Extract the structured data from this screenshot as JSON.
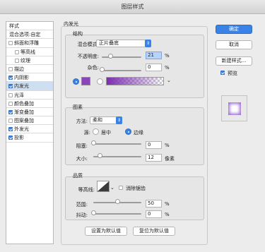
{
  "window": {
    "title": "图层样式"
  },
  "sidebar": {
    "items": [
      {
        "label": "样式",
        "checkbox": null,
        "checked": false,
        "indent": 0,
        "selected": false
      },
      {
        "label": "混合选项:自定",
        "checkbox": null,
        "checked": false,
        "indent": 0,
        "selected": false
      },
      {
        "label": "斜面和浮雕",
        "checkbox": true,
        "checked": false,
        "indent": 0,
        "selected": false
      },
      {
        "label": "等高线",
        "checkbox": true,
        "checked": false,
        "indent": 1,
        "selected": false
      },
      {
        "label": "纹理",
        "checkbox": true,
        "checked": false,
        "indent": 1,
        "selected": false
      },
      {
        "label": "描边",
        "checkbox": true,
        "checked": false,
        "indent": 0,
        "selected": false
      },
      {
        "label": "内阴影",
        "checkbox": true,
        "checked": true,
        "indent": 0,
        "selected": false
      },
      {
        "label": "内发光",
        "checkbox": true,
        "checked": true,
        "indent": 0,
        "selected": true
      },
      {
        "label": "光泽",
        "checkbox": true,
        "checked": false,
        "indent": 0,
        "selected": false
      },
      {
        "label": "颜色叠加",
        "checkbox": true,
        "checked": false,
        "indent": 0,
        "selected": false
      },
      {
        "label": "渐变叠加",
        "checkbox": true,
        "checked": true,
        "indent": 0,
        "selected": false
      },
      {
        "label": "图案叠加",
        "checkbox": true,
        "checked": false,
        "indent": 0,
        "selected": false
      },
      {
        "label": "外发光",
        "checkbox": true,
        "checked": true,
        "indent": 0,
        "selected": false
      },
      {
        "label": "投影",
        "checkbox": true,
        "checked": true,
        "indent": 0,
        "selected": false
      }
    ]
  },
  "panel": {
    "title": "内发光"
  },
  "structure": {
    "title": "结构",
    "blend_mode_label": "混合模式:",
    "blend_mode_value": "正片叠底",
    "opacity_label": "不透明度:",
    "opacity_value": "21",
    "opacity_level": 0.21,
    "noise_label": "杂色:",
    "noise_value": "0",
    "noise_level": 0,
    "percent": "%",
    "color_selected": "solid",
    "swatch_color": "#8a45b8",
    "gradient_color": "#7a2db0"
  },
  "elements": {
    "title": "图素",
    "method_label": "方法:",
    "method_value": "柔和",
    "source_label": "源:",
    "source_center": "居中",
    "source_edge": "边缘",
    "source_selected": "edge",
    "choke_label": "阻塞:",
    "choke_value": "0",
    "choke_level": 0,
    "size_label": "大小:",
    "size_value": "12",
    "size_unit": "像素",
    "percent": "%"
  },
  "quality": {
    "title": "品质",
    "contour_label": "等高线:",
    "antialias_label": "消除锯齿",
    "antialias_checked": false,
    "range_label": "范围:",
    "range_value": "50",
    "range_level": 0.5,
    "jitter_label": "抖动:",
    "jitter_value": "0",
    "jitter_level": 0,
    "percent": "%"
  },
  "buttons": {
    "make_default": "设置为默认值",
    "reset_default": "复位为默认值",
    "ok": "确定",
    "cancel": "取消",
    "new_style": "新建样式...",
    "preview_label": "预览",
    "preview_checked": true
  },
  "colors": {
    "accent": "#3b82e6",
    "glow": "#9b6ad1"
  }
}
